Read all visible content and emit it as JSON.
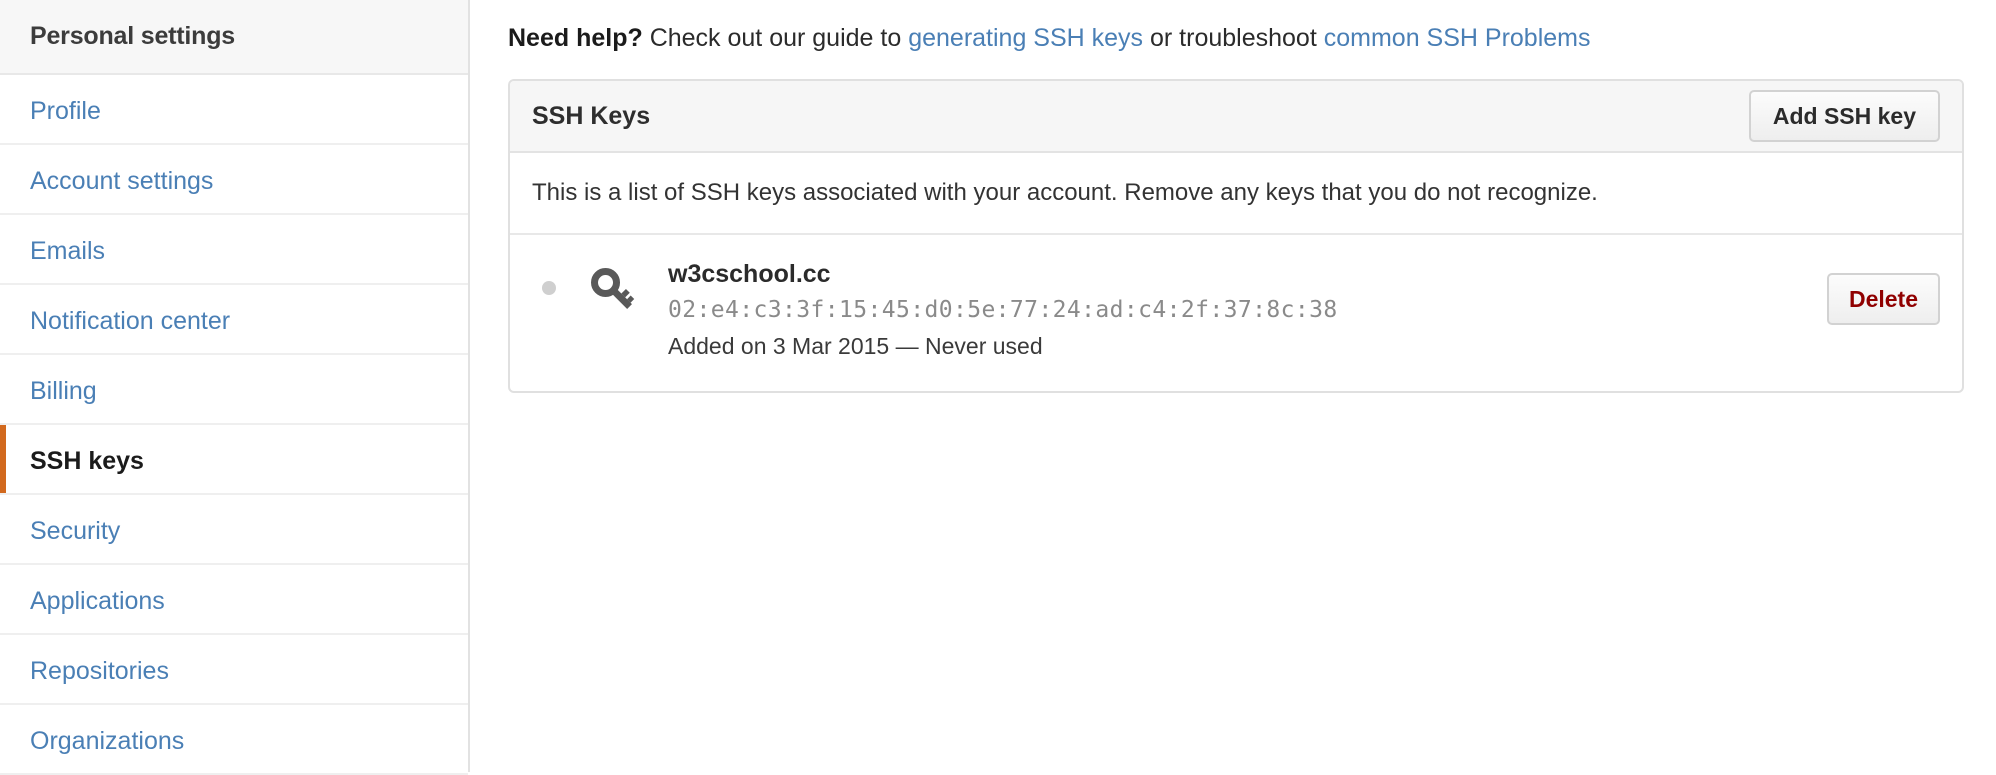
{
  "sidebar": {
    "header": "Personal settings",
    "items": [
      {
        "label": "Profile",
        "active": false
      },
      {
        "label": "Account settings",
        "active": false
      },
      {
        "label": "Emails",
        "active": false
      },
      {
        "label": "Notification center",
        "active": false
      },
      {
        "label": "Billing",
        "active": false
      },
      {
        "label": "SSH keys",
        "active": true
      },
      {
        "label": "Security",
        "active": false
      },
      {
        "label": "Applications",
        "active": false
      },
      {
        "label": "Repositories",
        "active": false
      },
      {
        "label": "Organizations",
        "active": false
      }
    ],
    "active_accent_color": "#d2691e",
    "link_color": "#4a7fb5"
  },
  "help": {
    "lead": "Need help?",
    "text_1": " Check out our guide to ",
    "link_1": "generating SSH keys",
    "text_2": " or troubleshoot ",
    "link_2": "common SSH Problems"
  },
  "panel": {
    "title": "SSH Keys",
    "add_button": "Add SSH key",
    "description": "This is a list of SSH keys associated with your account. Remove any keys that you do not recognize.",
    "keys": [
      {
        "name": "w3cschool.cc",
        "fingerprint": "02:e4:c3:3f:15:45:d0:5e:77:24:ad:c4:2f:37:8c:38",
        "meta": "Added on 3 Mar 2015 — Never used",
        "delete_button": "Delete",
        "status_color": "#cfcfcf",
        "icon": "key-icon"
      }
    ],
    "delete_color": "#900000"
  }
}
